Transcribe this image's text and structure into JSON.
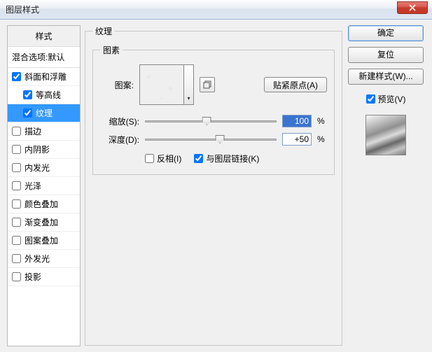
{
  "window": {
    "title": "图层样式"
  },
  "styles": {
    "header": "样式",
    "blend": "混合选项:默认",
    "items": [
      {
        "label": "斜面和浮雕",
        "checked": true,
        "child": false
      },
      {
        "label": "等高线",
        "checked": true,
        "child": true
      },
      {
        "label": "纹理",
        "checked": true,
        "child": true,
        "selected": true
      },
      {
        "label": "描边",
        "checked": false,
        "child": false
      },
      {
        "label": "内阴影",
        "checked": false,
        "child": false
      },
      {
        "label": "内发光",
        "checked": false,
        "child": false
      },
      {
        "label": "光泽",
        "checked": false,
        "child": false
      },
      {
        "label": "颜色叠加",
        "checked": false,
        "child": false
      },
      {
        "label": "渐变叠加",
        "checked": false,
        "child": false
      },
      {
        "label": "图案叠加",
        "checked": false,
        "child": false
      },
      {
        "label": "外发光",
        "checked": false,
        "child": false
      },
      {
        "label": "投影",
        "checked": false,
        "child": false
      }
    ]
  },
  "texture": {
    "group_label": "纹理",
    "element_group_label": "图素",
    "pattern_label": "图案:",
    "snap_origin": "贴紧原点(A)",
    "scale_label": "缩放(S):",
    "scale_value": "100",
    "scale_pct": "%",
    "scale_thumb_pct": 47,
    "depth_label": "深度(D):",
    "depth_value": "+50",
    "depth_pct": "%",
    "depth_thumb_pct": 57,
    "invert_label": "反相(I)",
    "invert_checked": false,
    "link_label": "与图层链接(K)",
    "link_checked": true
  },
  "buttons": {
    "ok": "确定",
    "reset": "复位",
    "new_style": "新建样式(W)...",
    "preview_label": "预览(V)",
    "preview_checked": true
  }
}
